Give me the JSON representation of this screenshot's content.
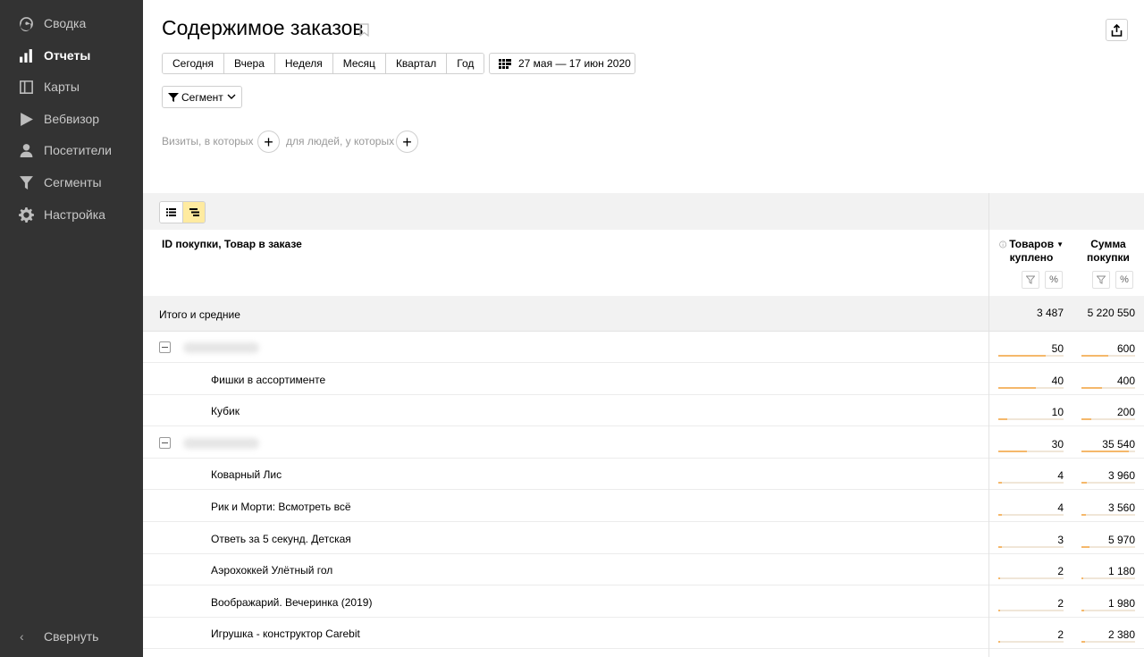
{
  "sidebar": {
    "items": [
      {
        "label": "Сводка",
        "icon": "dashboard-icon",
        "active": false
      },
      {
        "label": "Отчеты",
        "icon": "bar-chart-icon",
        "active": true
      },
      {
        "label": "Карты",
        "icon": "map-icon",
        "active": false
      },
      {
        "label": "Вебвизор",
        "icon": "play-icon",
        "active": false
      },
      {
        "label": "Посетители",
        "icon": "person-icon",
        "active": false
      },
      {
        "label": "Сегменты",
        "icon": "funnel-icon",
        "active": false
      },
      {
        "label": "Настройка",
        "icon": "gear-icon",
        "active": false
      }
    ],
    "collapse_label": "Свернуть"
  },
  "header": {
    "title": "Содержимое заказов"
  },
  "periods": [
    "Сегодня",
    "Вчера",
    "Неделя",
    "Месяц",
    "Квартал",
    "Год"
  ],
  "date_range": "27 мая — 17 июн 2020",
  "segment_label": "Сегмент",
  "conditions": {
    "visits_label": "Визиты, в которых",
    "people_label": "для людей, у которых"
  },
  "table": {
    "dimension_header": "ID покупки, Товар в заказе",
    "metric_headers": [
      {
        "line1": "Товаров",
        "line2": "куплено",
        "sorted": true
      },
      {
        "line1": "Сумма",
        "line2": "покупки",
        "sorted": false
      }
    ],
    "totals_label": "Итого и средние",
    "totals": [
      "3 487",
      "5 220 550"
    ],
    "rows": [
      {
        "type": "group",
        "label": "",
        "values": [
          "50",
          "600"
        ],
        "share": [
          0.72,
          0.5
        ]
      },
      {
        "type": "item",
        "label": "Фишки в ассортименте",
        "values": [
          "40",
          "400"
        ],
        "share": [
          0.58,
          0.38
        ]
      },
      {
        "type": "item",
        "label": "Кубик",
        "values": [
          "10",
          "200"
        ],
        "share": [
          0.14,
          0.18
        ]
      },
      {
        "type": "group",
        "label": "",
        "values": [
          "30",
          "35 540"
        ],
        "share": [
          0.44,
          0.88
        ]
      },
      {
        "type": "item",
        "label": "Коварный Лис",
        "values": [
          "4",
          "3 960"
        ],
        "share": [
          0.06,
          0.1
        ]
      },
      {
        "type": "item",
        "label": "Рик и Морти: Всмотреть всё",
        "values": [
          "4",
          "3 560"
        ],
        "share": [
          0.06,
          0.09
        ]
      },
      {
        "type": "item",
        "label": "Ответь за 5 секунд. Детская",
        "values": [
          "3",
          "5 970"
        ],
        "share": [
          0.05,
          0.15
        ]
      },
      {
        "type": "item",
        "label": "Аэрохоккей Улётный гол",
        "values": [
          "2",
          "1 180"
        ],
        "share": [
          0.03,
          0.03
        ]
      },
      {
        "type": "item",
        "label": "Воображарий. Вечеринка (2019)",
        "values": [
          "2",
          "1 980"
        ],
        "share": [
          0.03,
          0.05
        ]
      },
      {
        "type": "item",
        "label": "Игрушка - конструктор Carebit",
        "values": [
          "2",
          "2 380"
        ],
        "share": [
          0.03,
          0.06
        ]
      }
    ]
  },
  "colors": {
    "sidebar_bg": "#333333",
    "bar": "#f5b86b",
    "toggle_on": "#ffeba0"
  }
}
